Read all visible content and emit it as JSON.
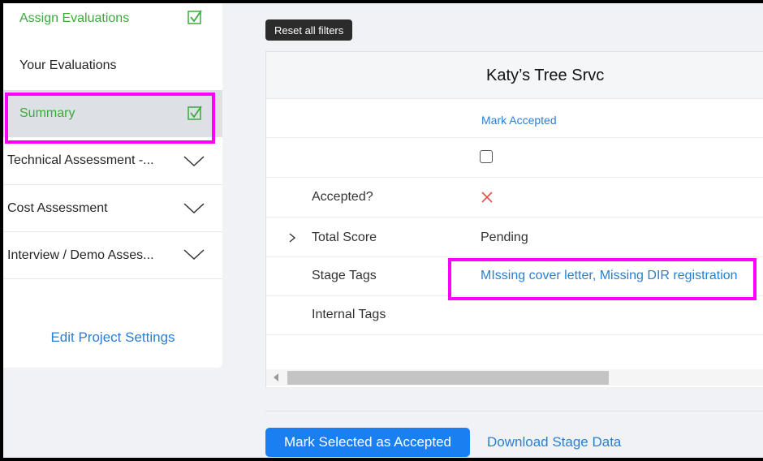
{
  "sidebar": {
    "items": [
      {
        "label": "Assign Evaluations",
        "checked": true
      },
      {
        "label": "Your Evaluations"
      },
      {
        "label": "Summary",
        "checked": true,
        "active": true
      },
      {
        "label": "Technical Assessment -..."
      },
      {
        "label": "Cost Assessment"
      },
      {
        "label": "Interview / Demo Asses..."
      }
    ],
    "edit_settings": "Edit Project Settings"
  },
  "toolbar": {
    "reset_label": "Reset all filters"
  },
  "table": {
    "vendor": "Katy’s Tree Srvc",
    "mark_accepted": "Mark Accepted",
    "rows": {
      "accepted": {
        "label": "Accepted?",
        "icon": "x-icon"
      },
      "total_score": {
        "label": "Total Score",
        "value": "Pending"
      },
      "stage_tags": {
        "label": "Stage Tags",
        "value": "MIssing cover letter, Missing DIR registration"
      },
      "internal_tags": {
        "label": "Internal Tags"
      }
    }
  },
  "footer": {
    "mark_selected": "Mark Selected as Accepted",
    "download": "Download Stage Data"
  },
  "colors": {
    "accent": "#1a7ff0",
    "link": "#2a7fd4",
    "success": "#3aab3a",
    "highlight": "#ff00ff",
    "danger": "#e0504a"
  }
}
